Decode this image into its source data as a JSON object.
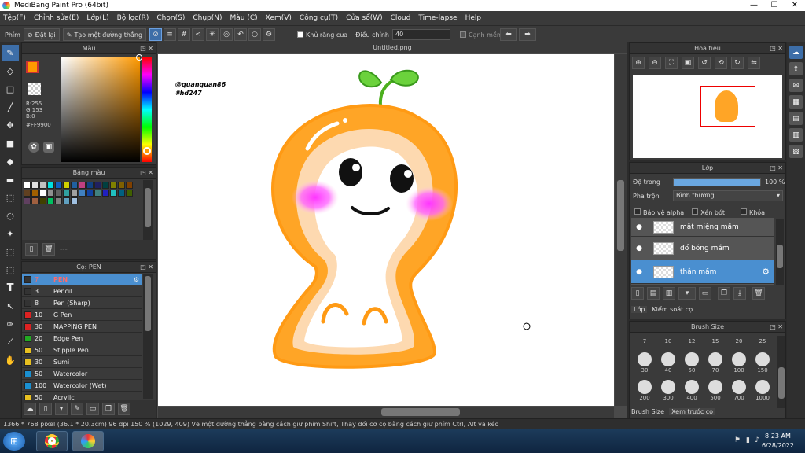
{
  "window": {
    "title": "MediBang Paint Pro (64bit)"
  },
  "menu": [
    "Tệp(F)",
    "Chỉnh sửa(E)",
    "Lớp(L)",
    "Bộ lọc(R)",
    "Chọn(S)",
    "Chụp(N)",
    "Màu (C)",
    "Xem(V)",
    "Công cụ(T)",
    "Cửa sổ(W)",
    "Cloud",
    "Time-lapse",
    "Help"
  ],
  "toolbar": {
    "brush_label": "Phím",
    "reset": "Đặt lại",
    "straight_line": "Tạo một đường thẳng",
    "antialias": "Khử răng cưa",
    "adjust": "Điều chỉnh",
    "adjust_value": "40",
    "soft_edge": "Cạnh mềm"
  },
  "color_panel": {
    "title": "Màu",
    "r": "R:255",
    "g": "G:153",
    "b": "B:0",
    "hex": "#FF9900",
    "fg": "#FF9900"
  },
  "palette_panel": {
    "title": "Bảng màu",
    "more": "---",
    "colors": [
      "#ffffff",
      "#e0e0e0",
      "#c0c0c0",
      "#00e0e0",
      "#1060c0",
      "#d0d000",
      "#2060a0",
      "#c04080",
      "#104080",
      "#202060",
      "#004040",
      "#808000",
      "#806000",
      "#804000",
      "#604020",
      "#a06000",
      "#ffffff",
      "#909090",
      "#606060",
      "#30a0a0",
      "#a0a0a0",
      "#4080c0",
      "#1040a0",
      "#408080",
      "#2020c0",
      "#20c0c0",
      "#006080",
      "#406000",
      "#604060",
      "#a06040",
      "#404000",
      "#00c060",
      "#808080",
      "#60a0c0",
      "#a0c0e0"
    ]
  },
  "brush_panel": {
    "title": "Cọ: PEN",
    "items": [
      {
        "size": "7",
        "name": "PEN",
        "color": "#333333"
      },
      {
        "size": "3",
        "name": "Pencil",
        "color": "#333333"
      },
      {
        "size": "8",
        "name": "Pen (Sharp)",
        "color": "#333333"
      },
      {
        "size": "10",
        "name": "G Pen",
        "color": "#dd2222"
      },
      {
        "size": "30",
        "name": "MAPPING PEN",
        "color": "#dd2222"
      },
      {
        "size": "20",
        "name": "Edge Pen",
        "color": "#22aa22"
      },
      {
        "size": "50",
        "name": "Stipple Pen",
        "color": "#e8c020"
      },
      {
        "size": "30",
        "name": "Sumi",
        "color": "#e8c020"
      },
      {
        "size": "50",
        "name": "Watercolor",
        "color": "#1a8fd0"
      },
      {
        "size": "100",
        "name": "Watercolor (Wet)",
        "color": "#1a8fd0"
      },
      {
        "size": "50",
        "name": "Acrylic",
        "color": "#e8c020"
      }
    ]
  },
  "document": {
    "tab": "Untitled.png",
    "watermark_1": "@quanquan86",
    "watermark_2": "#hd247"
  },
  "navigator": {
    "title": "Hoa tiêu"
  },
  "layer_panel": {
    "title": "Lớp",
    "opacity_label": "Độ trong",
    "opacity_value": "100 %",
    "opacity_fraction": 1.0,
    "blend_label": "Pha trộn",
    "blend_value": "Bình thường",
    "protect_alpha": "Bảo vệ alpha",
    "clip": "Xén bớt",
    "lock": "Khóa",
    "layers": [
      "mắt miệng mầm",
      "đổ bóng mầm",
      "thân mầm"
    ],
    "tab_layer": "Lớp",
    "tab_control": "Kiểm soát cọ"
  },
  "brush_size_panel": {
    "title": "Brush Size",
    "sizes": [
      "7",
      "10",
      "12",
      "15",
      "20",
      "25",
      "30",
      "40",
      "50",
      "70",
      "100",
      "150",
      "200",
      "300",
      "400",
      "500",
      "700",
      "1000"
    ],
    "tab_size": "Brush Size",
    "tab_preview": "Xem trước cọ"
  },
  "status": {
    "text": "1366 * 768 pixel   (36.1 * 20.3cm)   96 dpi   150 %   (1029, 409)   Vẽ một đường thẳng bằng cách giữ phím Shift, Thay đổi cỡ cọ bằng cách giữ phím Ctrl, Alt và kéo"
  },
  "taskbar": {
    "time": "8:23 AM",
    "date": "6/28/2022"
  }
}
